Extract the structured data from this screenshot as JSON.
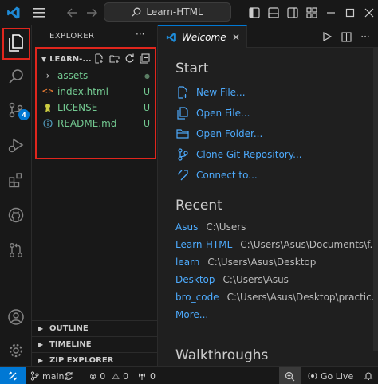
{
  "titlebar": {
    "command_center": "Learn-HTML"
  },
  "activitybar": {
    "source_control_badge": "4"
  },
  "sidebar": {
    "title": "EXPLORER",
    "more": "···",
    "folder": "LEARN-...",
    "items": [
      {
        "label": "assets",
        "status": "●",
        "icon": "chevron-right-icon"
      },
      {
        "label": "index.html",
        "status": "U",
        "icon": "html-file-icon"
      },
      {
        "label": "LICENSE",
        "status": "U",
        "icon": "license-icon"
      },
      {
        "label": "README.md",
        "status": "U",
        "icon": "info-icon"
      }
    ],
    "sections": [
      "OUTLINE",
      "TIMELINE",
      "ZIP EXPLORER"
    ]
  },
  "editor": {
    "tab_label": "Welcome",
    "start_heading": "Start",
    "start_items": [
      "New File...",
      "Open File...",
      "Open Folder...",
      "Clone Git Repository...",
      "Connect to..."
    ],
    "recent_heading": "Recent",
    "recent": [
      {
        "name": "Asus",
        "path": "C:\\Users"
      },
      {
        "name": "Learn-HTML",
        "path": "C:\\Users\\Asus\\Documents\\f..."
      },
      {
        "name": "learn",
        "path": "C:\\Users\\Asus\\Desktop"
      },
      {
        "name": "Desktop",
        "path": "C:\\Users\\Asus"
      },
      {
        "name": "bro_code",
        "path": "C:\\Users\\Asus\\Desktop\\practic..."
      }
    ],
    "more": "More...",
    "walkthroughs_heading": "Walkthroughs"
  },
  "statusbar": {
    "branch": "main*",
    "errors": "0",
    "warnings": "0",
    "ports": "0",
    "go_live": "Go Live"
  },
  "colors": {
    "accent": "#0078d4",
    "highlight": "#e0261d",
    "link": "#4daafc",
    "untracked": "#73c991"
  }
}
